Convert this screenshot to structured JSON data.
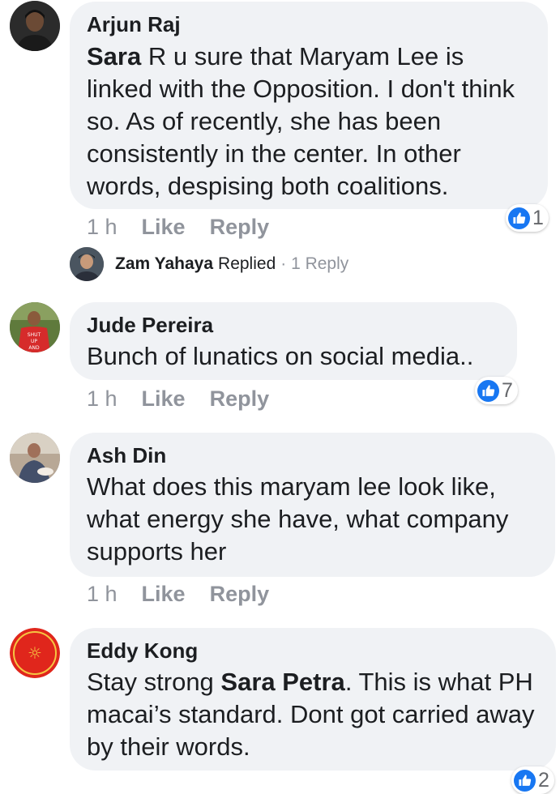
{
  "comments": [
    {
      "author": "Arjun Raj",
      "mention": "Sara",
      "text": " R u sure that Maryam Lee is linked with the Opposition. I don't think so. As of recently, she has been consistently in the center. In other words, despising both coalitions.",
      "time": "1 h",
      "like_label": "Like",
      "reply_label": "Reply",
      "reactions": "1"
    },
    {
      "author": "Jude Pereira",
      "text": "Bunch of lunatics on social media..",
      "time": "1 h",
      "like_label": "Like",
      "reply_label": "Reply",
      "reactions": "7"
    },
    {
      "author": "Ash Din",
      "text": "What does this maryam lee look like, what energy she have, what company supports her",
      "time": "1 h",
      "like_label": "Like",
      "reply_label": "Reply"
    },
    {
      "author": "Eddy Kong",
      "text_before": "Stay strong ",
      "mention": "Sara Petra",
      "text_after": ". This is what PH macai’s standard. Dont got carried away by their words.",
      "reactions": "2"
    }
  ],
  "reply_summary": {
    "name": "Zam Yahaya",
    "verb": "Replied",
    "count": "· 1 Reply"
  },
  "colors": {
    "bubble": "#f0f2f5",
    "like_blue": "#1877f2",
    "meta_gray": "#90949c"
  },
  "icons": [
    "like-icon"
  ]
}
